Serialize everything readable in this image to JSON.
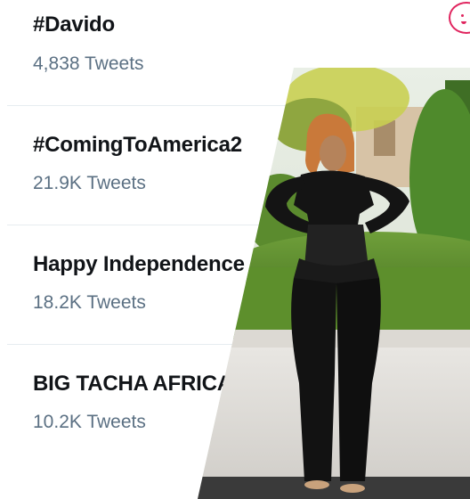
{
  "trends": [
    {
      "title": "#Davido",
      "count": "4,838 Tweets"
    },
    {
      "title": "#ComingToAmerica2",
      "count": "21.9K Tweets"
    },
    {
      "title": "Happy Independence",
      "count": "18.2K Tweets"
    },
    {
      "title": "BIG TACHA AFRICA",
      "count": "10.2K Tweets"
    }
  ],
  "colors": {
    "title": "#111418",
    "count": "#5b7083",
    "divider": "#e6ecf0",
    "icon": "#e0245e"
  },
  "icons": {
    "corner": "smiley-icon"
  }
}
